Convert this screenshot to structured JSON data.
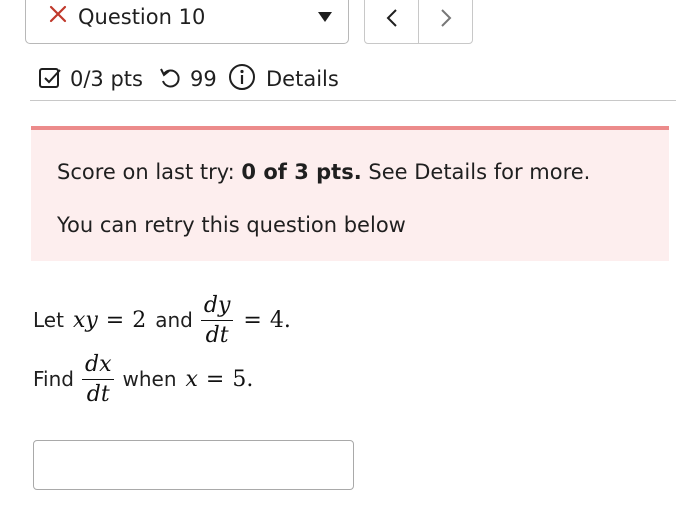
{
  "question_selector": {
    "label": "Question 10",
    "status_icon": "x-icon",
    "status_color": "#c0392b"
  },
  "nav": {
    "prev_icon": "chevron-left-icon",
    "next_icon": "chevron-right-icon"
  },
  "meta": {
    "points": "0/3 pts",
    "attempts": "99",
    "details_label": "Details"
  },
  "banner": {
    "score_prefix": "Score on last try:",
    "score_value": "0 of 3 pts.",
    "score_suffix": "See Details for more.",
    "retry_text": "You can retry this question below",
    "accent_color": "#ec8b8b",
    "background_color": "#fdeeee"
  },
  "problem": {
    "line1": {
      "let": "Let",
      "lhs_var1": "x",
      "lhs_var2": "y",
      "equals": "=",
      "lhs_value": "2",
      "and": "and",
      "deriv_num": "dy",
      "deriv_den": "dt",
      "equals2": "=",
      "deriv_value": "4."
    },
    "line2": {
      "find": "Find",
      "deriv_num": "dx",
      "deriv_den": "dt",
      "when": "when",
      "var": "x",
      "equals": "=",
      "value": "5."
    }
  },
  "answer_input": {
    "value": "",
    "placeholder": ""
  }
}
